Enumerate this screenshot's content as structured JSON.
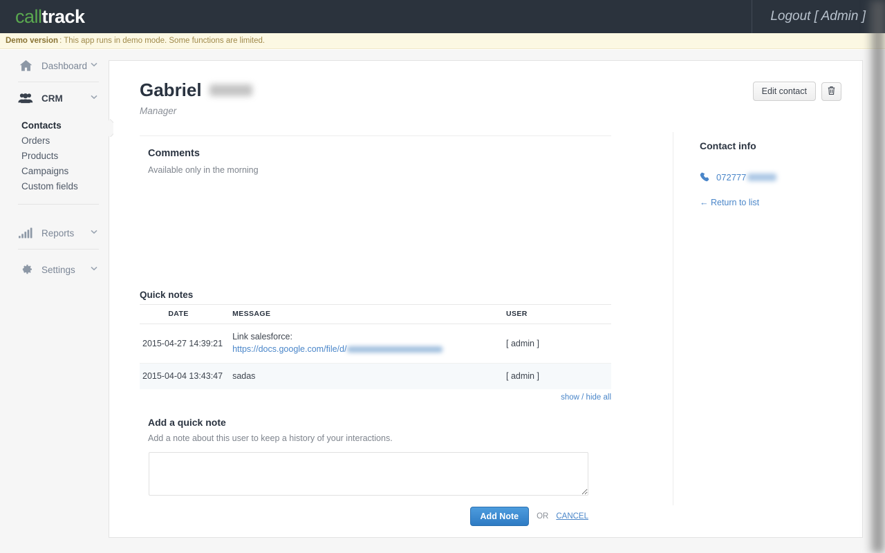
{
  "topbar": {
    "logo_part1": "call",
    "logo_part2": "track",
    "logout_label": "Logout [ Admin ]"
  },
  "banner": {
    "strong": "Demo version",
    "text": ": This app runs in demo mode. Some functions are limited."
  },
  "sidebar": {
    "groups": [
      {
        "label": "Dashboard",
        "icon": "home-icon",
        "chevron": "⌄",
        "active": false,
        "items": []
      },
      {
        "label": "CRM",
        "icon": "users-icon",
        "chevron": "⌄",
        "active": true,
        "items": [
          {
            "label": "Contacts",
            "active": true
          },
          {
            "label": "Orders",
            "active": false
          },
          {
            "label": "Products",
            "active": false
          },
          {
            "label": "Campaigns",
            "active": false
          },
          {
            "label": "Custom fields",
            "active": false
          }
        ]
      },
      {
        "label": "Reports",
        "icon": "bar-chart-icon",
        "chevron": "⌄",
        "active": false,
        "items": []
      },
      {
        "label": "Settings",
        "icon": "gear-icon",
        "chevron": "⌄",
        "active": false,
        "items": []
      }
    ]
  },
  "contact": {
    "first_name": "Gabriel",
    "last_name_redacted": true,
    "role": "Manager",
    "edit_button": "Edit contact",
    "delete_icon": "trash-icon"
  },
  "comments": {
    "heading": "Comments",
    "body": "Available only in the morning"
  },
  "quick_notes": {
    "heading": "Quick notes",
    "columns": [
      "DATE",
      "MESSAGE",
      "USER"
    ],
    "rows": [
      {
        "date": "2015-04-27 14:39:21",
        "message_line1": "Link salesforce:",
        "message_link": "https://docs.google.com/file/d/",
        "message_link_redacted": true,
        "user": "[ admin ]"
      },
      {
        "date": "2015-04-04 13:43:47",
        "message_line1": "sadas",
        "message_link": "",
        "message_link_redacted": false,
        "user": "[ admin ]"
      }
    ],
    "show_hide_label": "show / hide all"
  },
  "add_note": {
    "heading": "Add a quick note",
    "description": "Add a note about this user to keep a history of your interactions.",
    "textarea_value": "",
    "textarea_placeholder": "",
    "submit_label": "Add Note",
    "or_label": "OR",
    "cancel_label": "CANCEL"
  },
  "contact_info": {
    "heading": "Contact info",
    "phone_icon": "phone-icon",
    "phone_number": "072777",
    "phone_redacted": true,
    "return_label": "← Return to list"
  },
  "colors": {
    "topbar_bg": "#2b333d",
    "logo_green": "#5aa84f",
    "banner_bg": "#fcf8e3",
    "banner_text": "#a08a4b",
    "link_blue": "#4a86c9",
    "primary_button": "#2e7bc4",
    "alt_row_bg": "#f6f9fb"
  }
}
